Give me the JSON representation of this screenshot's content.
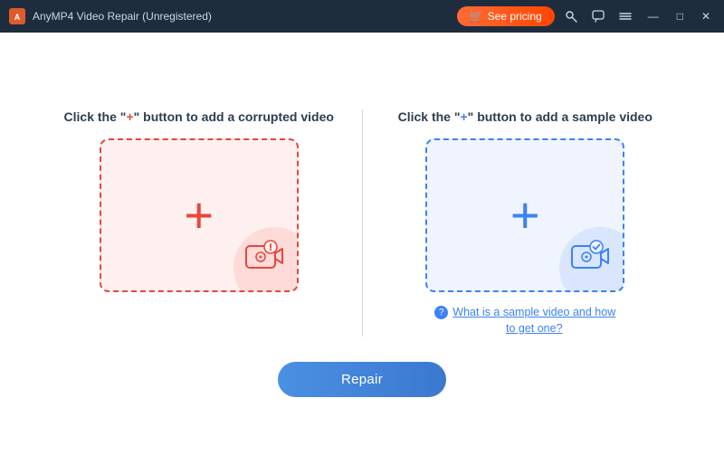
{
  "titlebar": {
    "app_icon_text": "A",
    "title": "AnyMP4 Video Repair (Unregistered)",
    "pricing_btn_label": "See pricing",
    "pricing_icon": "🛒",
    "icons": [
      "🔑",
      "💬",
      "☰"
    ],
    "win_buttons": [
      "—",
      "□",
      "✕"
    ]
  },
  "left_panel": {
    "label_before": "Click the \"",
    "label_plus": "+",
    "label_after": "\" button to add a corrupted video",
    "box_type": "red",
    "aria_label": "Add corrupted video"
  },
  "right_panel": {
    "label_before": "Click the \"",
    "label_plus": "+",
    "label_after": "\" button to add a sample video",
    "box_type": "blue",
    "aria_label": "Add sample video",
    "help_text": "What is a sample video and how to get one?"
  },
  "repair_btn": {
    "label": "Repair"
  }
}
